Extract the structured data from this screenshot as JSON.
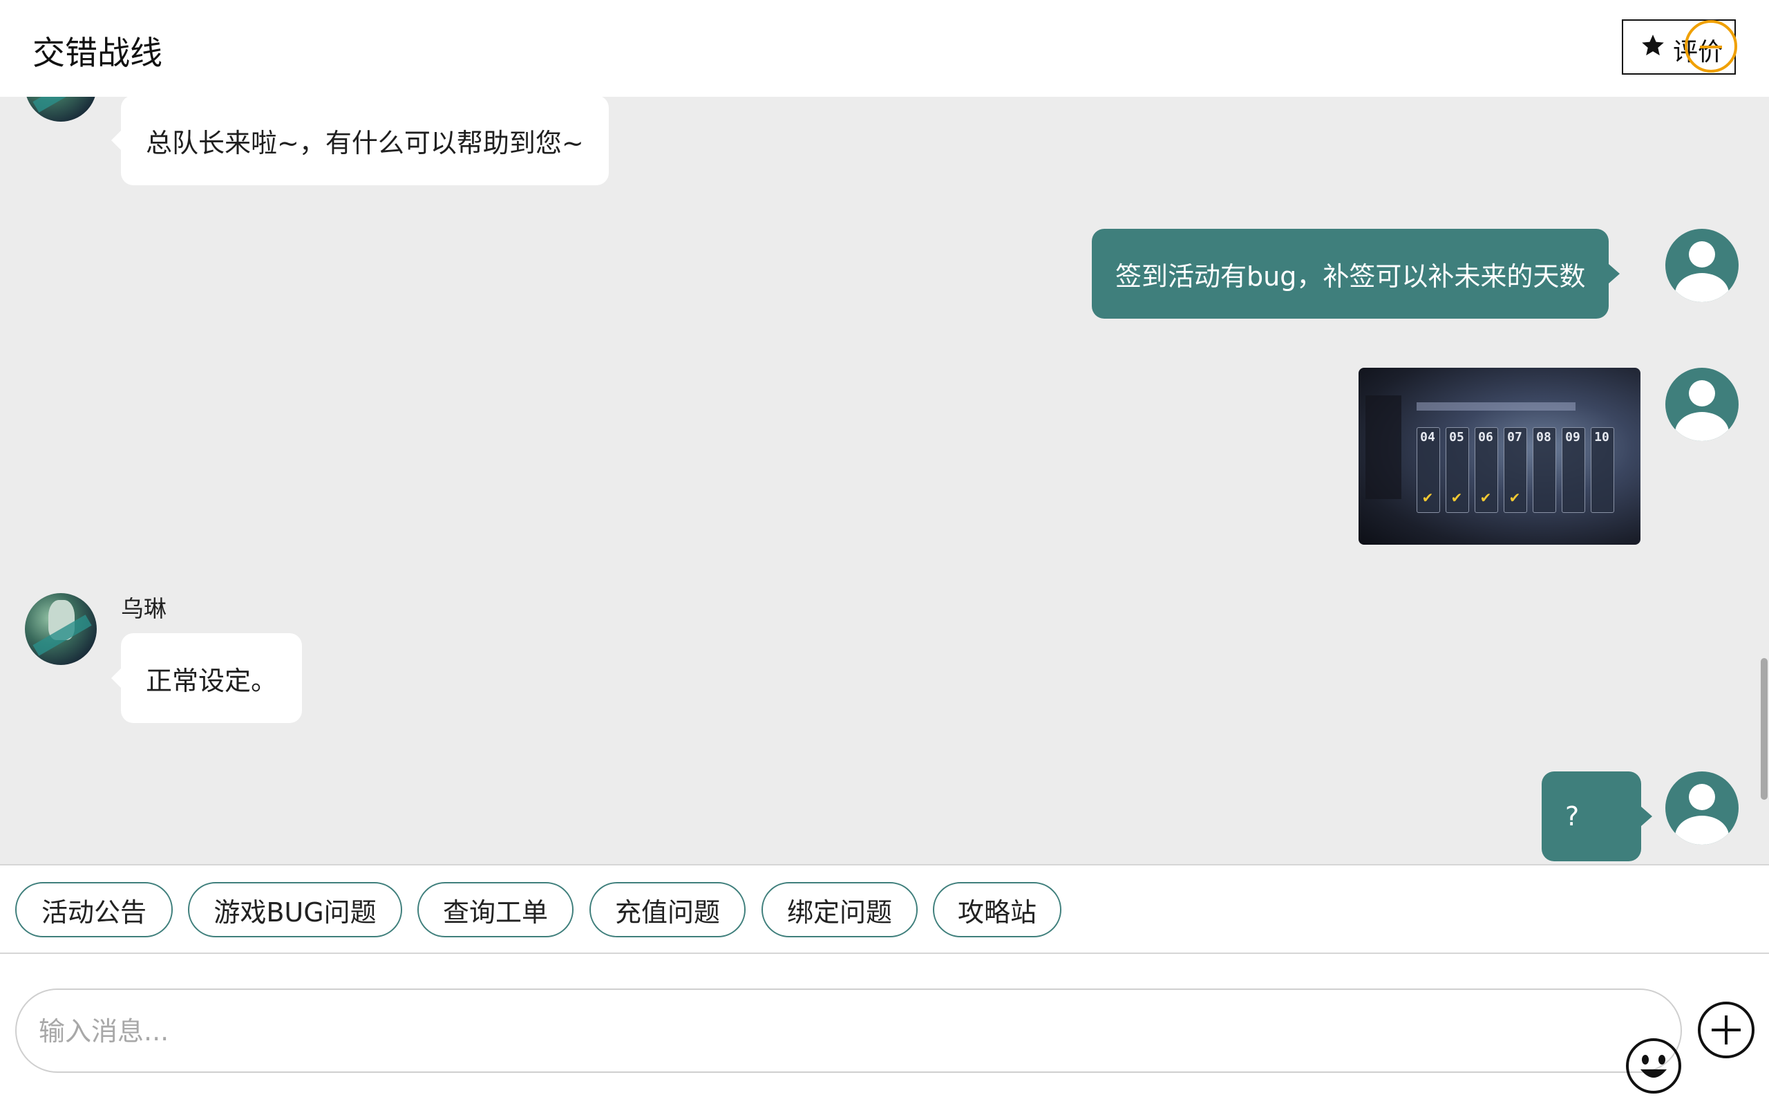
{
  "header": {
    "title": "交错战线",
    "rate_label": "评价"
  },
  "messages": [
    {
      "from": "agent",
      "text": "总队长来啦~，有什么可以帮助到您~"
    },
    {
      "from": "user",
      "text": "签到活动有bug，补签可以补未来的天数"
    },
    {
      "from": "user",
      "type": "image",
      "image_days": [
        "04",
        "05",
        "06",
        "07",
        "08",
        "09",
        "10"
      ]
    },
    {
      "from": "agent",
      "name": "乌琳",
      "text": "正常设定。"
    },
    {
      "from": "user",
      "text": "?"
    }
  ],
  "quick_replies": [
    "活动公告",
    "游戏BUG问题",
    "查询工单",
    "充值问题",
    "绑定问题",
    "攻略站"
  ],
  "input": {
    "value": "",
    "placeholder": "输入消息..."
  },
  "colors": {
    "accent": "#3f7f7c",
    "chat_background": "#ececec",
    "highlight": "#f0a000"
  },
  "icons": [
    "star-icon",
    "emoji-icon",
    "plus-icon",
    "user-avatar-icon"
  ]
}
